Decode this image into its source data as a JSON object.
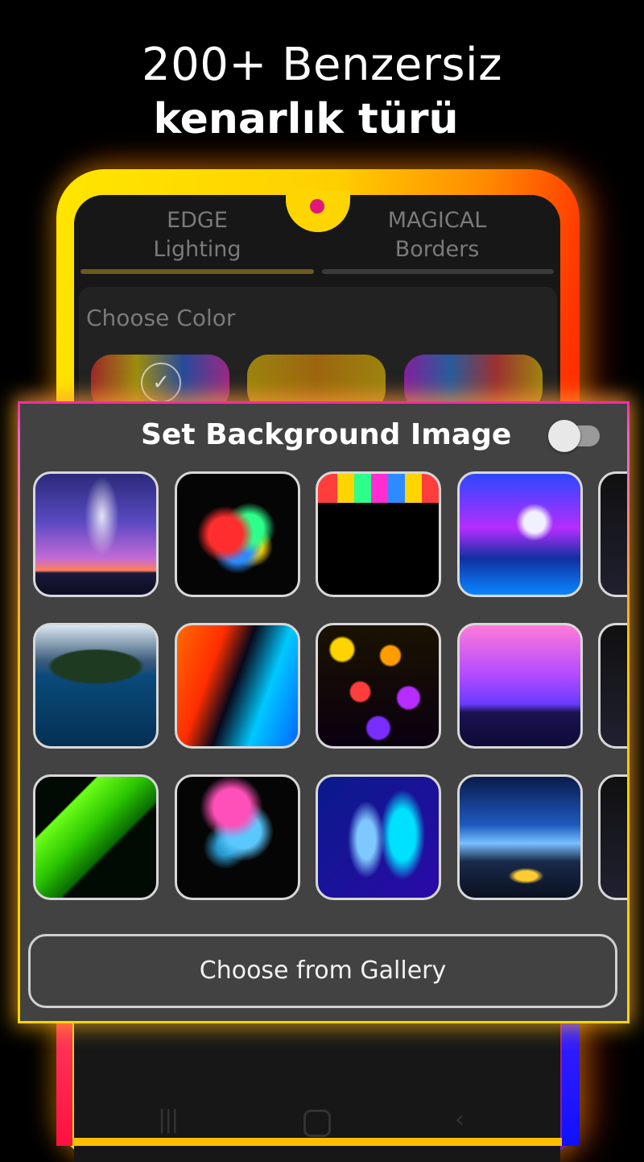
{
  "headline": {
    "line1": "200+ Benzersiz",
    "line2": "kenarlık türü"
  },
  "tabs": [
    {
      "label_top": "EDGE",
      "label_bottom": "Lighting",
      "active": true
    },
    {
      "label_top": "MAGICAL",
      "label_bottom": "Borders",
      "active": false
    }
  ],
  "color_panel": {
    "title": "Choose Color",
    "selected_index": 0
  },
  "dialog": {
    "title": "Set Background Image",
    "toggle_on": false,
    "gallery_button": "Choose from Gallery",
    "thumbnails": [
      "galaxy-silhouette",
      "neon-splash",
      "paint-drip",
      "girl-on-chair",
      "floating-island",
      "fire-and-ice",
      "colorful-leaves",
      "aurora-sky",
      "green-fern",
      "color-smoke",
      "blue-curves",
      "tent-under-milky-way"
    ]
  },
  "colors": {
    "dialog_bg": "#424242",
    "accent_yellow": "#ffd400",
    "accent_pink": "#ff2aa0"
  },
  "nav_icons": [
    "recent-apps-icon",
    "home-icon",
    "back-icon"
  ]
}
